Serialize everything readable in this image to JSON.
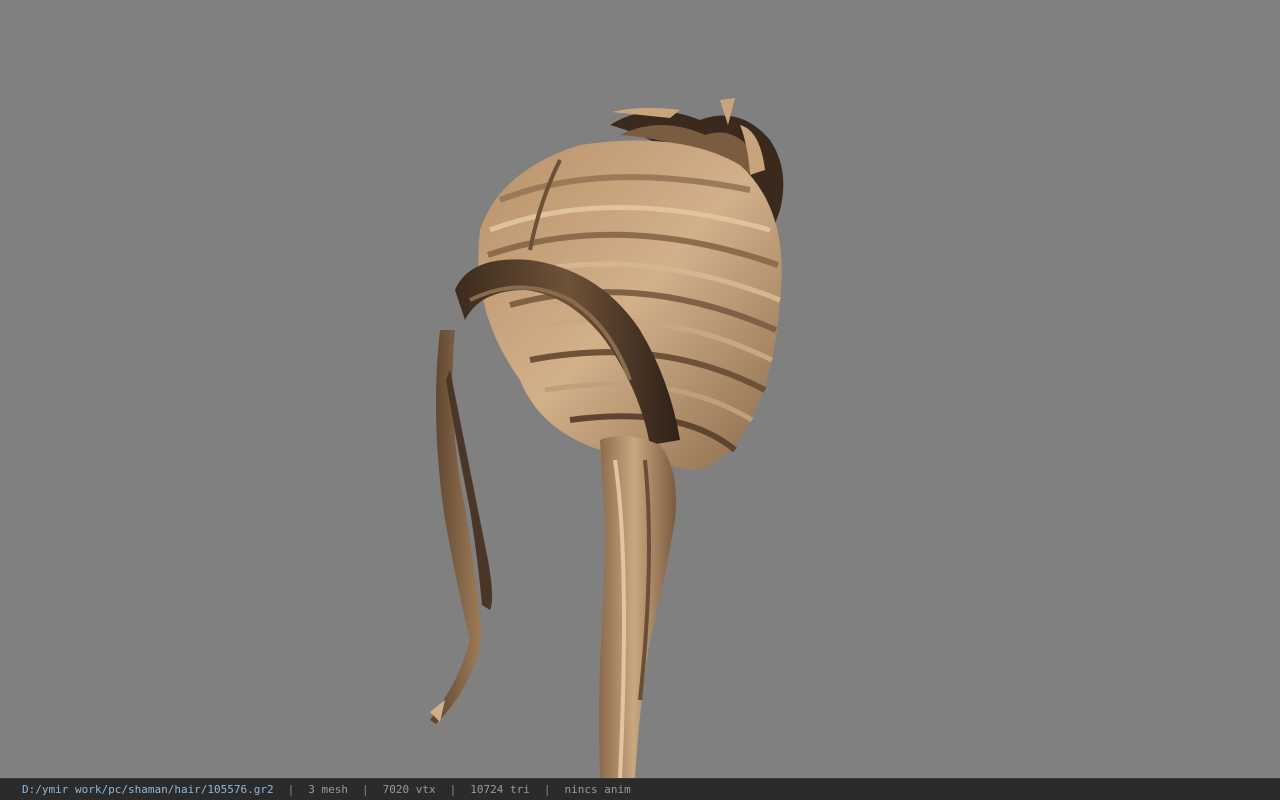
{
  "viewport": {
    "background_color": "#808080",
    "model": {
      "description_icon": "hair-mesh-render",
      "colors": {
        "light": "#c9a57e",
        "mid": "#9c7a56",
        "dark": "#4a3626",
        "darkest": "#2e2118"
      }
    }
  },
  "statusbar": {
    "file_path": "D:/ymir work/pc/shaman/hair/105576.gr2",
    "sep1": "|",
    "mesh": "3 mesh",
    "sep2": "|",
    "vtx": "7020 vtx",
    "sep3": "|",
    "tri": "10724 tri",
    "sep4": "|",
    "anim": "nincs anim",
    "path_color": "#8fb7d8",
    "text_color": "#9a9a9a"
  }
}
